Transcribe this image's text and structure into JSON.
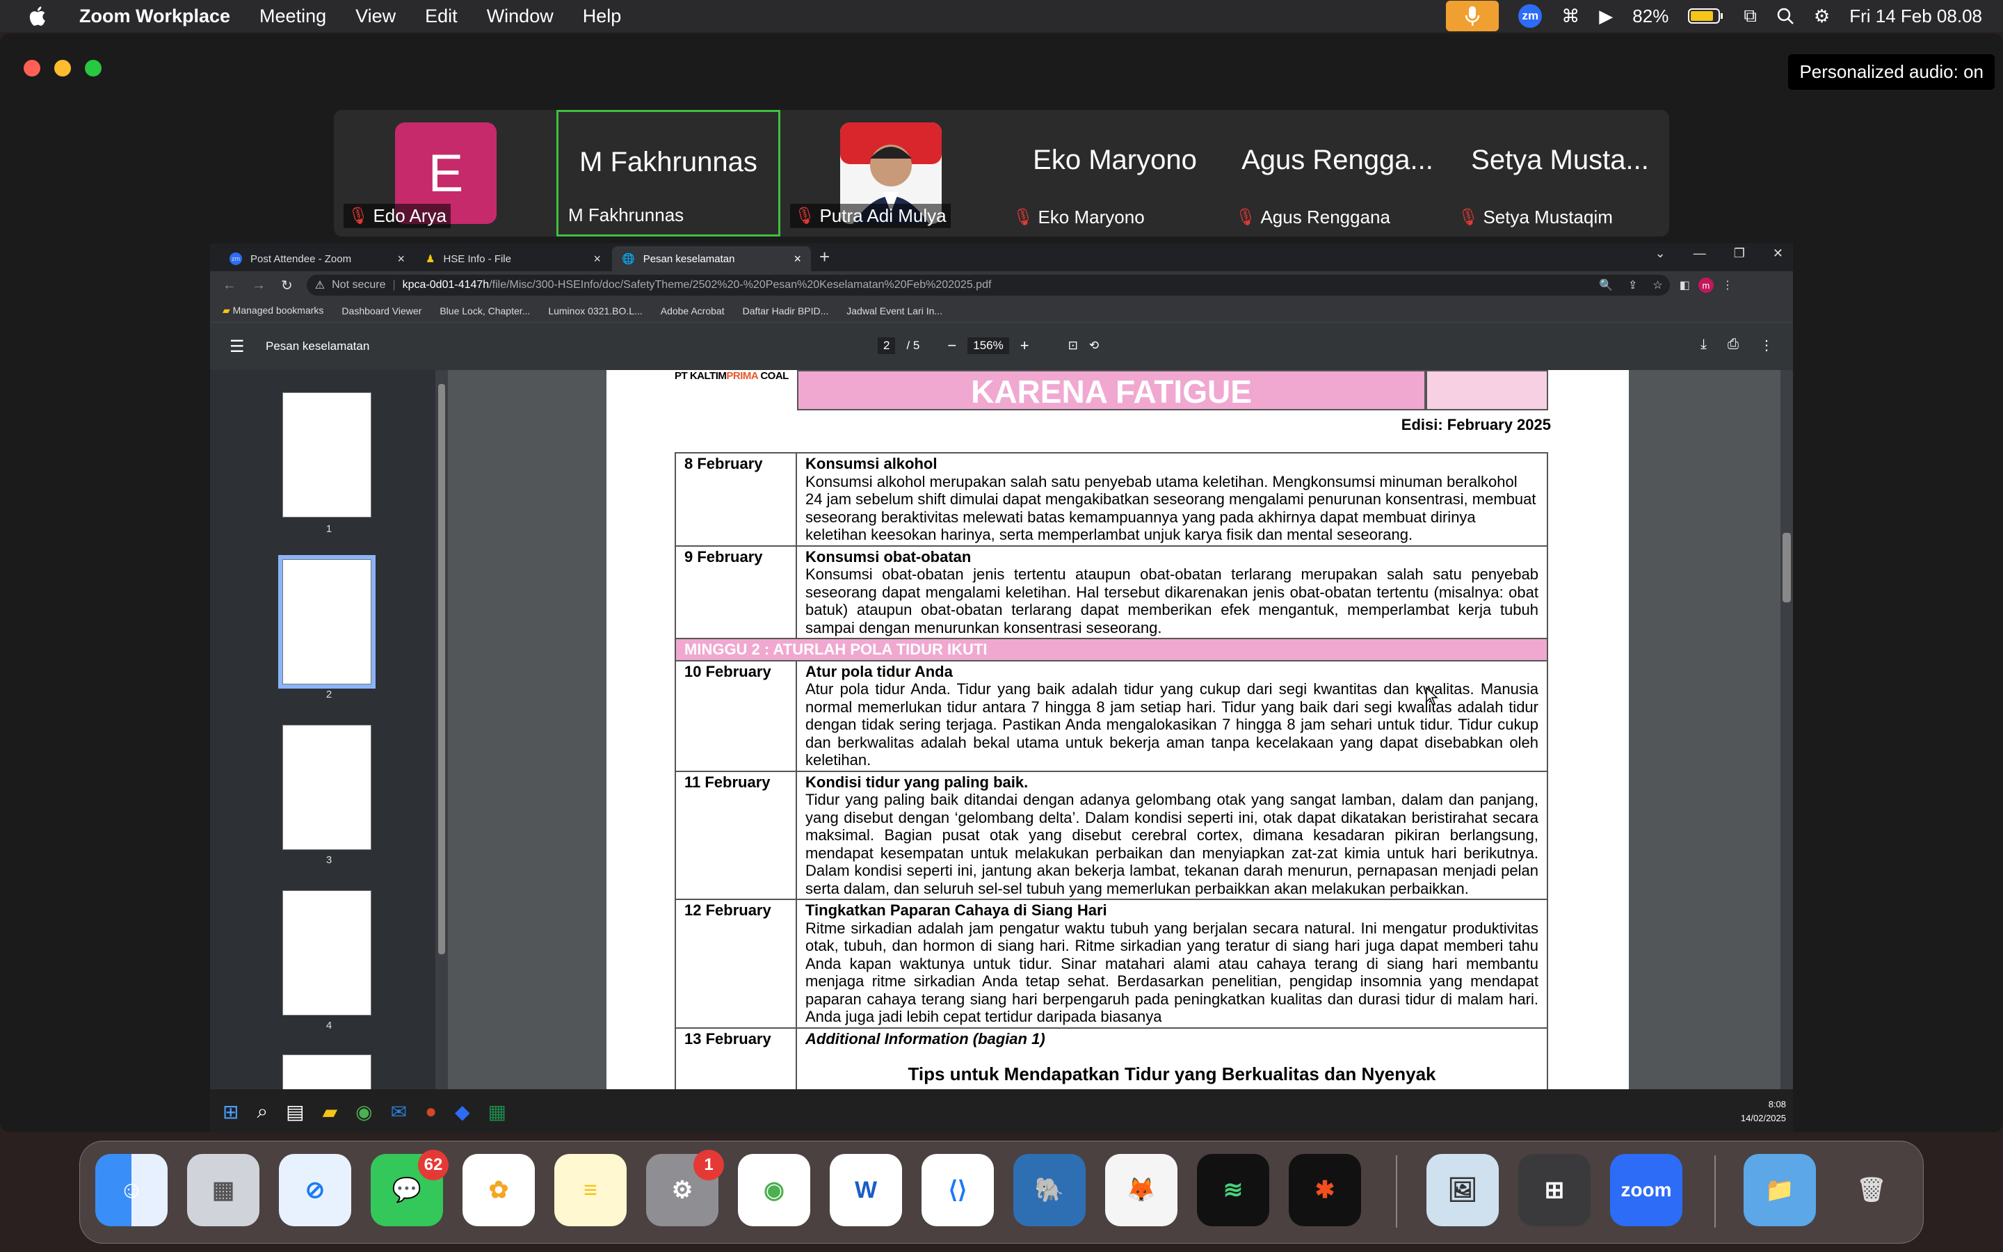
{
  "menubar": {
    "app_name": "Zoom Workplace",
    "items": [
      "Meeting",
      "View",
      "Edit",
      "Window",
      "Help"
    ],
    "battery": "82%",
    "datetime": "Fri 14 Feb  08.08"
  },
  "zoom": {
    "personalized_audio": "Personalized audio: on",
    "participants": [
      {
        "tile_text": "E",
        "name": "Edo Arya"
      },
      {
        "tile_text": "M Fakhrunnas",
        "name": "M Fakhrunnas"
      },
      {
        "tile_text": "",
        "name": "Putra Adi Mulya"
      },
      {
        "tile_text": "Eko Maryono",
        "name": "Eko Maryono"
      },
      {
        "tile_text": "Agus Rengga...",
        "name": "Agus Renggana"
      },
      {
        "tile_text": "Setya Musta...",
        "name": "Setya Mustaqim"
      }
    ]
  },
  "browser": {
    "tabs": [
      "Post Attendee - Zoom",
      "HSE Info - File",
      "Pesan keselamatan"
    ],
    "security": "Not secure",
    "url_host": "kpca-0d01-4147h",
    "url_path": "/file/Misc/300-HSEInfo/doc/SafetyTheme/2502%20-%20Pesan%20Keselamatan%20Feb%202025.pdf",
    "bookmarks": [
      "Managed bookmarks",
      "Dashboard Viewer",
      "Blue Lock, Chapter...",
      "Luminox 0321.BO.L...",
      "Adobe Acrobat",
      "Daftar Hadir BPID...",
      "Jadwal Event Lari In..."
    ]
  },
  "pdf": {
    "title": "Pesan keselamatan",
    "page_current": "2",
    "page_total": "/ 5",
    "zoom": "156%",
    "thumbnail_labels": [
      "1",
      "2",
      "3",
      "4"
    ],
    "company_prefix": "PT KALTIM",
    "company_highlight": "PRIMA",
    "company_suffix": " COAL",
    "banner": "KARENA FATIGUE",
    "edition": "Edisi: February 2025",
    "rows": [
      {
        "date": "8 February",
        "title": "Konsumsi alkohol",
        "body": "Konsumsi alkohol merupakan salah satu penyebab utama keletihan. Mengkonsumsi minuman beralkohol 24 jam sebelum shift dimulai dapat mengakibatkan seseorang mengalami penurunan konsentrasi, membuat seseorang beraktivitas melewati batas kemampuannya yang pada akhirnya dapat membuat dirinya keletihan keesokan harinya, serta memperlambat unjuk karya fisik dan mental seseorang."
      },
      {
        "date": "9 February",
        "title": "Konsumsi obat-obatan",
        "body": "Konsumsi obat-obatan jenis tertentu ataupun obat-obatan terlarang merupakan salah satu penyebab seseorang dapat mengalami keletihan. Hal tersebut dikarenakan jenis obat-obatan tertentu (misalnya: obat batuk) ataupun obat-obatan terlarang dapat memberikan efek mengantuk, memperlambat kerja tubuh sampai dengan menurunkan konsentrasi seseorang."
      },
      {
        "date": "10 February",
        "title": "Atur pola tidur Anda",
        "body": "Atur pola tidur Anda. Tidur yang baik adalah tidur yang cukup dari segi kwantitas dan kwalitas. Manusia normal memerlukan tidur antara 7 hingga 8 jam setiap hari. Tidur yang baik dari segi kwalitas adalah tidur dengan tidak sering terjaga. Pastikan Anda mengalokasikan 7 hingga 8 jam sehari untuk tidur. Tidur cukup dan berkwalitas adalah bekal utama untuk bekerja aman tanpa kecelakaan yang dapat disebabkan oleh keletihan."
      },
      {
        "date": "11 February",
        "title": "Kondisi tidur yang paling baik.",
        "body": "Tidur yang paling baik ditandai dengan adanya gelombang otak yang sangat lamban, dalam dan panjang, yang disebut dengan ‘gelombang delta’. Dalam kondisi seperti ini, otak dapat dikatakan beristirahat secara maksimal. Bagian pusat otak yang disebut cerebral cortex, dimana kesadaran pikiran berlangsung, mendapat kesempatan untuk melakukan perbaikan dan menyiapkan zat-zat kimia untuk hari berikutnya. Dalam kondisi seperti ini, jantung akan bekerja lambat, tekanan darah menurun, pernapasan menjadi pelan serta dalam, dan seluruh sel-sel tubuh yang memerlukan perbaikkan akan melakukan perbaikkan."
      },
      {
        "date": "12 February",
        "title": "Tingkatkan Paparan Cahaya di Siang Hari",
        "body": "Ritme sirkadian adalah jam pengatur waktu tubuh yang berjalan secara natural. Ini mengatur produktivitas otak, tubuh, dan hormon di siang hari. Ritme sirkadian yang teratur di siang hari juga dapat memberi tahu Anda kapan waktunya untuk tidur. Sinar matahari alami atau cahaya terang di siang hari membantu menjaga ritme sirkadian Anda tetap sehat. Berdasarkan penelitian, pengidap insomnia yang mendapat paparan cahaya terang siang hari berpengaruh pada peningkatkan kualitas dan durasi tidur di malam hari. Anda juga jadi lebih cepat tertidur daripada biasanya"
      }
    ],
    "week_banner": "MINGGU 2 : ATURLAH POLA TIDUR IKUTI",
    "row13_date": "13 February",
    "row13_title": "Additional Information (bagian 1)",
    "row13_heading": "Tips untuk Mendapatkan Tidur yang Berkualitas dan Nyenyak"
  },
  "taskbar": {
    "time": "8:08",
    "date": "14/02/2025"
  },
  "dock": {
    "messages_badge": "62",
    "settings_badge": "1",
    "zoom_label": "zoom"
  },
  "colors": {
    "pink_banner": "#f0a8d0",
    "zoom_active": "#3fbf3f",
    "edo_avatar": "#c62a6b"
  }
}
